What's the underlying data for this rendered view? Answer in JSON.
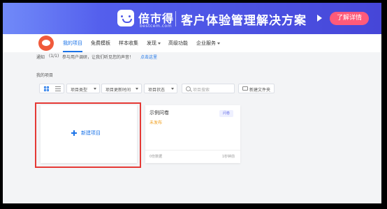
{
  "banner": {
    "brand_name": "倍市得",
    "brand_domain": "bestcem.com",
    "slogan": "客户体验管理解决方案",
    "cta_label": "了解详情"
  },
  "header": {
    "nav": [
      {
        "label": "我的项目",
        "active": true
      },
      {
        "label": "免费模板"
      },
      {
        "label": "样本收集"
      },
      {
        "label": "发现"
      },
      {
        "label": "高级功能"
      },
      {
        "label": "企业服务"
      }
    ]
  },
  "notice": {
    "prefix": "通知",
    "page": "(1/1)",
    "message": "参与用户调研，让我们听见您的声音！",
    "link_label": "点击这里"
  },
  "section_title": "我的项目",
  "toolbar": {
    "filters": [
      {
        "label": "项目类型"
      },
      {
        "label": "项目更新时间"
      },
      {
        "label": "项目状态"
      }
    ],
    "search_placeholder": "项目搜索",
    "new_folder_label": "新建文件夹"
  },
  "new_project_label": "新建项目",
  "project": {
    "title": "示例问卷",
    "badge": "问卷",
    "status": "未发布",
    "count": "0份数据",
    "time": "1秒钟前"
  },
  "colors": {
    "accent": "#1a73e8",
    "banner": "#4f59e8",
    "highlight": "#e53935",
    "status": "#f0a020"
  }
}
